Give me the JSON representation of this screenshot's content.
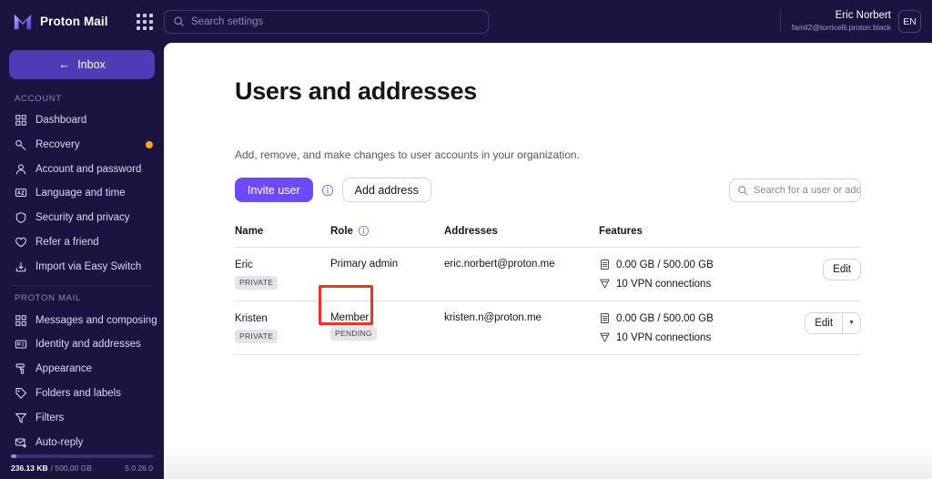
{
  "brand": {
    "name": "Proton Mail",
    "app_grid_icon": "app-grid-icon"
  },
  "search": {
    "placeholder": "Search settings",
    "icon": "search-icon"
  },
  "account": {
    "name": "Eric Norbert",
    "email": "famil2@torricelli.proton.black",
    "initials": "EN"
  },
  "sidebar": {
    "inbox_button": {
      "label": "Inbox",
      "arrow": "←"
    },
    "sections": [
      {
        "title": "ACCOUNT",
        "items": [
          {
            "label": "Dashboard",
            "icon": "dashboard-icon",
            "dot": false
          },
          {
            "label": "Recovery",
            "icon": "key-icon",
            "dot": true
          },
          {
            "label": "Account and password",
            "icon": "user-icon",
            "dot": false
          },
          {
            "label": "Language and time",
            "icon": "language-icon",
            "dot": false
          },
          {
            "label": "Security and privacy",
            "icon": "shield-icon",
            "dot": false
          },
          {
            "label": "Refer a friend",
            "icon": "heart-icon",
            "dot": false
          },
          {
            "label": "Import via Easy Switch",
            "icon": "import-icon",
            "dot": false
          }
        ]
      },
      {
        "title": "PROTON MAIL",
        "items": [
          {
            "label": "Messages and composing",
            "icon": "grid-icon",
            "dot": false
          },
          {
            "label": "Identity and addresses",
            "icon": "id-card-icon",
            "dot": false
          },
          {
            "label": "Appearance",
            "icon": "paint-roller-icon",
            "dot": false
          },
          {
            "label": "Folders and labels",
            "icon": "tag-icon",
            "dot": false
          },
          {
            "label": "Filters",
            "icon": "filter-icon",
            "dot": false
          },
          {
            "label": "Auto-reply",
            "icon": "auto-reply-icon",
            "dot": false
          }
        ]
      }
    ],
    "storage": {
      "used": "236.13 KB",
      "total": "/ 500.00 GB",
      "percent": 4,
      "version": "5.0.26.0"
    }
  },
  "main": {
    "title": "Users and addresses",
    "description": "Add, remove, and make changes to user accounts in your organization.",
    "invite_user_label": "Invite user",
    "info_icon": "info-icon",
    "add_address_label": "Add address",
    "user_search_placeholder": "Search for a user or add",
    "table": {
      "headers": {
        "name": "Name",
        "role": "Role",
        "addresses": "Addresses",
        "features": "Features",
        "role_info_icon": "info-icon"
      },
      "rows": [
        {
          "name": "Eric",
          "name_tag": "PRIVATE",
          "role": "Primary admin",
          "role_tag": "",
          "address": "eric.norbert@proton.me",
          "storage": "0.00 GB / 500.00 GB",
          "vpn": "10 VPN connections",
          "edit_label": "Edit",
          "has_dropdown": false,
          "highlighted": false
        },
        {
          "name": "Kristen",
          "name_tag": "PRIVATE",
          "role": "Member",
          "role_tag": "PENDING",
          "address": "kristen.n@proton.me",
          "storage": "0.00 GB / 500.00 GB",
          "vpn": "10 VPN connections",
          "edit_label": "Edit",
          "has_dropdown": true,
          "highlighted": true
        }
      ]
    }
  },
  "colors": {
    "sidebar_bg": "#1c1340",
    "accent_purple": "#6d4aff",
    "inbox_button": "#4d3cb5",
    "notification_dot": "#f5a623",
    "highlight_box": "#ee3524"
  }
}
